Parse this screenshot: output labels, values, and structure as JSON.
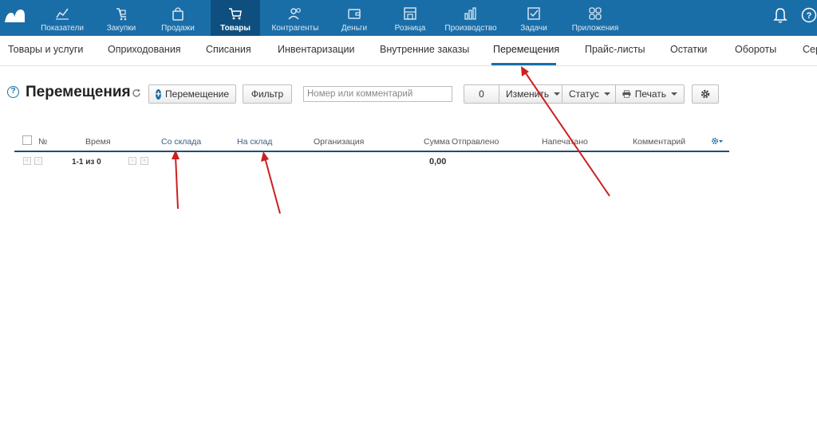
{
  "topnav": {
    "items": [
      {
        "label": "Показатели",
        "icon": "chart-icon"
      },
      {
        "label": "Закупки",
        "icon": "purchase-icon"
      },
      {
        "label": "Продажи",
        "icon": "bag-icon"
      },
      {
        "label": "Товары",
        "icon": "cart-icon",
        "active": true
      },
      {
        "label": "Контрагенты",
        "icon": "people-icon"
      },
      {
        "label": "Деньги",
        "icon": "wallet-icon"
      },
      {
        "label": "Розница",
        "icon": "store-icon"
      },
      {
        "label": "Производство",
        "icon": "factory-icon"
      },
      {
        "label": "Задачи",
        "icon": "task-icon"
      },
      {
        "label": "Приложения",
        "icon": "apps-icon"
      }
    ],
    "color": "#1a6ea8",
    "active_color": "#0f4f7f"
  },
  "subnav": {
    "items": [
      "Товары и услуги",
      "Оприходования",
      "Списания",
      "Инвентаризации",
      "Внутренние заказы",
      "Перемещения",
      "Прайс-листы",
      "Остатки",
      "Обороты",
      "Сер"
    ],
    "active": "Перемещения"
  },
  "toolbar": {
    "title": "Перемещения",
    "help_label": "?",
    "add_button_label": "Перемещение",
    "filter_button_label": "Фильтр",
    "search_placeholder": "Номер или комментарий",
    "count_value": "0",
    "change_label": "Изменить",
    "status_label": "Статус",
    "print_label": "Печать"
  },
  "table": {
    "columns": [
      "№",
      "Время",
      "Со склада",
      "На склад",
      "Организация",
      "Сумма",
      "Отправлено",
      "Напечатано",
      "Комментарий"
    ],
    "pager_text": "1-1 из 0",
    "sum_total": "0,00"
  },
  "annotation_color": "#cc1f1f"
}
